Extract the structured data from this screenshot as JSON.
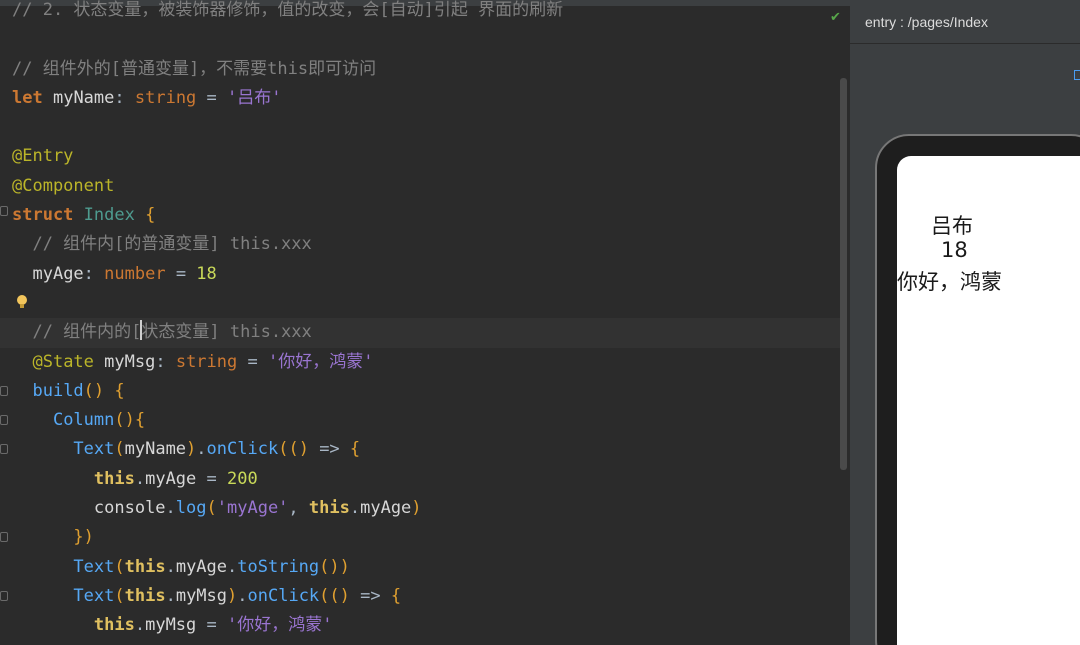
{
  "editor": {
    "lines": [
      {
        "t": "// 2. 状态变量，被装饰器修饰，值的改变，会[自动]引起 界面的刷新",
        "kind": "comment"
      },
      {
        "t": "",
        "kind": "blank"
      },
      {
        "t": "// 组件外的[普通变量]，不需要this即可访问",
        "kind": "comment"
      },
      {
        "t": "let myName: string = '吕布'",
        "kind": "code"
      },
      {
        "t": "",
        "kind": "blank"
      },
      {
        "t": "@Entry",
        "kind": "code"
      },
      {
        "t": "@Component",
        "kind": "code"
      },
      {
        "t": "struct Index {",
        "kind": "code"
      },
      {
        "t": "  // 组件内[的普通变量] this.xxx",
        "kind": "comment"
      },
      {
        "t": "  myAge: number = 18",
        "kind": "code"
      },
      {
        "t": "",
        "kind": "blank"
      },
      {
        "t": "  // 组件内的[状态变量] this.xxx",
        "kind": "comment"
      },
      {
        "t": "  @State myMsg: string = '你好，鸿蒙'",
        "kind": "code"
      },
      {
        "t": "  build() {",
        "kind": "code"
      },
      {
        "t": "    Column(){",
        "kind": "code"
      },
      {
        "t": "      Text(myName).onClick(() => {",
        "kind": "code"
      },
      {
        "t": "        this.myAge = 200",
        "kind": "code"
      },
      {
        "t": "        console.log('myAge', this.myAge)",
        "kind": "code"
      },
      {
        "t": "      })",
        "kind": "code"
      },
      {
        "t": "      Text(this.myAge.toString())",
        "kind": "code"
      },
      {
        "t": "      Text(this.myMsg).onClick(() => {",
        "kind": "code"
      },
      {
        "t": "        this.myMsg = '你好，鸿蒙'",
        "kind": "code"
      }
    ]
  },
  "preview": {
    "title": "entry : /pages/Index",
    "texts": [
      "吕布",
      "18",
      "你好，鸿蒙"
    ]
  },
  "colors": {
    "editor_bg": "#2b2b2b",
    "comment": "#808080",
    "keyword": "#cc7832",
    "string": "#9a75d1",
    "number": "#6897bb",
    "decorator": "#bbb529",
    "function": "#56a8f5"
  },
  "icons": {
    "status": "check-icon",
    "hint": "lightbulb-icon"
  }
}
